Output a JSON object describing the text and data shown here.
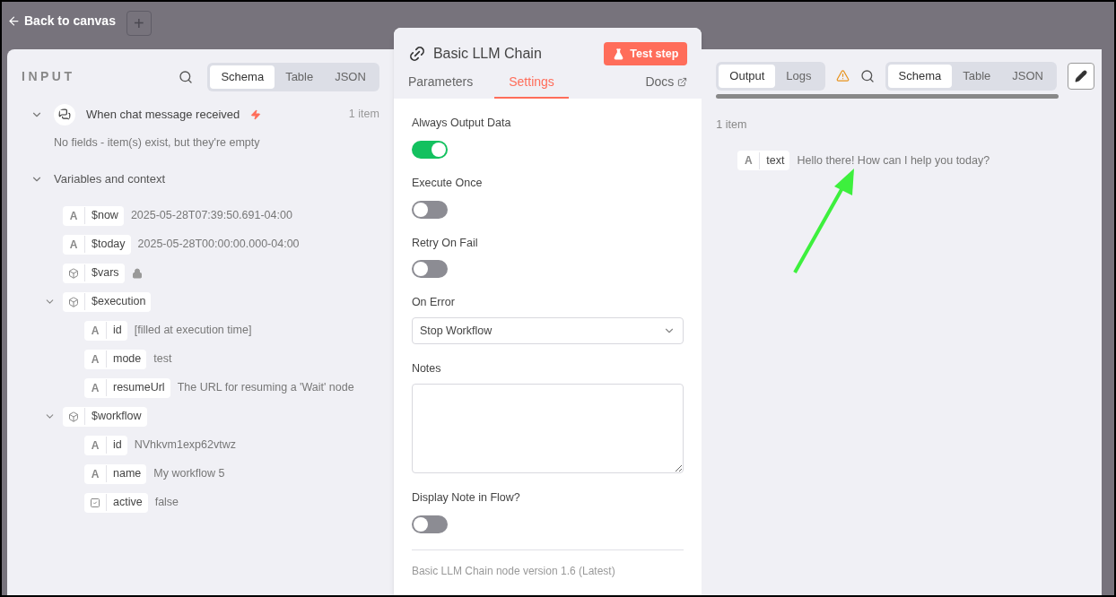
{
  "top_bar": {
    "back_link": "Back to canvas",
    "add_button": "+"
  },
  "input_panel": {
    "title": "INPUT",
    "view_tabs": [
      {
        "label": "Schema",
        "selected": true
      },
      {
        "label": "Table",
        "selected": false
      },
      {
        "label": "JSON",
        "selected": false
      }
    ],
    "node": {
      "title": "When chat message received",
      "count": "1 item",
      "expanded": true,
      "note": "No fields - item(s) exist, but they're empty"
    },
    "variables": {
      "label": "Variables and context",
      "expanded": true,
      "fields": [
        {
          "kind": "string",
          "type_letter": "A",
          "name": "$now",
          "value": "2025-05-28T07:39:50.691-04:00"
        },
        {
          "kind": "string",
          "type_letter": "A",
          "name": "$today",
          "value": "2025-05-28T00:00:00.000-04:00"
        },
        {
          "kind": "object",
          "name": "$vars",
          "locked": true
        },
        {
          "kind": "object",
          "name": "$execution",
          "expanded": true,
          "children": [
            {
              "kind": "string",
              "type_letter": "A",
              "name": "id",
              "value": "[filled at execution time]"
            },
            {
              "kind": "string",
              "type_letter": "A",
              "name": "mode",
              "value": "test"
            },
            {
              "kind": "string",
              "type_letter": "A",
              "name": "resumeUrl",
              "value": "The URL for resuming a 'Wait' node"
            }
          ]
        },
        {
          "kind": "object",
          "name": "$workflow",
          "expanded": true,
          "children": [
            {
              "kind": "string",
              "type_letter": "A",
              "name": "id",
              "value": "NVhkvm1exp62vtwz"
            },
            {
              "kind": "string",
              "type_letter": "A",
              "name": "name",
              "value": "My workflow 5"
            },
            {
              "kind": "boolean",
              "name": "active",
              "value": "false"
            }
          ]
        }
      ]
    }
  },
  "node_panel": {
    "title": "Basic LLM Chain",
    "test_button": "Test step",
    "tabs": [
      {
        "label": "Parameters",
        "selected": false
      },
      {
        "label": "Settings",
        "selected": true
      }
    ],
    "docs_link": "Docs",
    "settings": [
      {
        "kind": "toggle",
        "label": "Always Output Data",
        "on": true
      },
      {
        "kind": "toggle",
        "label": "Execute Once",
        "on": false
      },
      {
        "kind": "toggle",
        "label": "Retry On Fail",
        "on": false
      },
      {
        "kind": "select",
        "label": "On Error",
        "value": "Stop Workflow"
      },
      {
        "kind": "textarea",
        "label": "Notes"
      },
      {
        "kind": "toggle",
        "label": "Display Note in Flow?",
        "on": false
      }
    ],
    "footer": "Basic LLM Chain node version 1.6 (Latest)"
  },
  "output_panel": {
    "tabs": [
      {
        "label": "Output",
        "selected": true
      },
      {
        "label": "Logs",
        "selected": false
      }
    ],
    "view_tabs": [
      {
        "label": "Schema",
        "selected": true
      },
      {
        "label": "Table",
        "selected": false
      },
      {
        "label": "JSON",
        "selected": false
      }
    ],
    "count": "1 item",
    "fields": [
      {
        "kind": "string",
        "type_letter": "A",
        "name": "text",
        "value": "Hello there! How can I help you today?"
      }
    ]
  }
}
